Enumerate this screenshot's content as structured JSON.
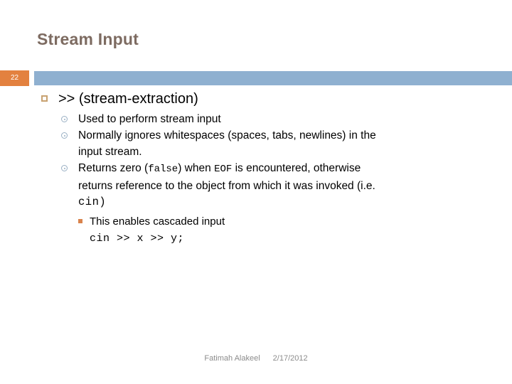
{
  "slide": {
    "title": "Stream Input",
    "page_number": "22",
    "colors": {
      "title": "#7d6b61",
      "badge": "#e3813f",
      "band": "#8fb0d0",
      "bullet_l1": "#c8a271",
      "bullet_l2": "#9ab0c4",
      "bullet_l3": "#d9834c",
      "footer": "#8c8c8c"
    },
    "heading": ">> (stream-extraction)",
    "bullets": [
      {
        "text": "Used to perform stream input"
      },
      {
        "text": "Normally ignores whitespaces (spaces, tabs, newlines) in the",
        "continuation": "input stream."
      },
      {
        "text_before_code": "Returns zero (",
        "code_1": "false",
        "text_middle": ") when ",
        "code_2": "EOF",
        "text_after": " is encountered, otherwise",
        "continuation": "returns reference to the object from which it was invoked (i.e.",
        "continuation_code": "cin)"
      }
    ],
    "sub_bullets": [
      {
        "text": "This enables cascaded input"
      }
    ],
    "code_line": "cin >> x >> y;",
    "footer": {
      "author": "Fatimah Alakeel",
      "date": "2/17/2012"
    }
  }
}
